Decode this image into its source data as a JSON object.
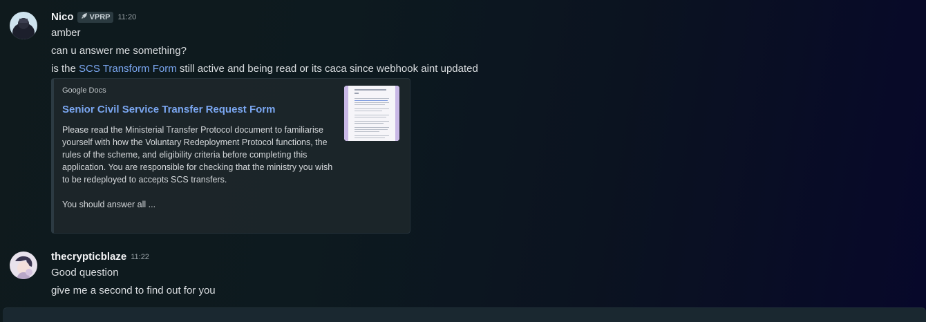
{
  "messages": [
    {
      "username": "Nico",
      "role_tag": "VPRP",
      "time": "11:20",
      "lines": [
        "amber",
        "can u answer me something?"
      ],
      "link_line": {
        "before": "is the ",
        "link_text": "SCS Transform Form",
        "after": " still active and being read or its caca since webhook aint updated"
      },
      "embed": {
        "provider": "Google Docs",
        "title": "Senior Civil Service Transfer Request Form",
        "description": "Please read the Ministerial Transfer Protocol document to familiarise yourself with how the Voluntary Redeployment Protocol functions, the rules of the scheme, and eligibility criteria before completing this application. You are responsible for checking that the ministry you wish to be redeployed to accepts SCS transfers.\n\nYou should answer all ..."
      }
    },
    {
      "username": "thecrypticblaze",
      "time": "11:22",
      "lines": [
        "Good question",
        "give me a second to find out for you"
      ]
    }
  ],
  "colors": {
    "link": "#7aa6f0",
    "username": "#f2f3f5",
    "text": "#dbdee1"
  }
}
